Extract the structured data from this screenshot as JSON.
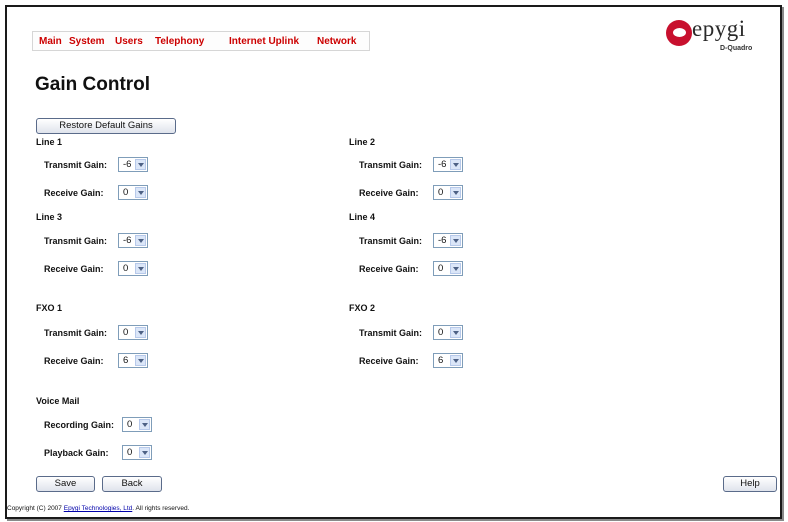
{
  "nav": {
    "items": [
      "Main",
      "System",
      "Users",
      "Telephony",
      "Internet Uplink",
      "Network"
    ]
  },
  "logo": {
    "word": "epygi",
    "sub": "D-Quadro"
  },
  "page_title": "Gain Control",
  "restore_button": "Restore Default Gains",
  "labels": {
    "transmit": "Transmit Gain:",
    "receive": "Receive Gain:",
    "recording": "Recording Gain:",
    "playback": "Playback Gain:"
  },
  "sections": {
    "line1": {
      "title": "Line 1",
      "transmit": "-6",
      "receive": "0"
    },
    "line2": {
      "title": "Line 2",
      "transmit": "-6",
      "receive": "0"
    },
    "line3": {
      "title": "Line 3",
      "transmit": "-6",
      "receive": "0"
    },
    "line4": {
      "title": "Line 4",
      "transmit": "-6",
      "receive": "0"
    },
    "fxo1": {
      "title": "FXO 1",
      "transmit": "0",
      "receive": "6"
    },
    "fxo2": {
      "title": "FXO 2",
      "transmit": "0",
      "receive": "6"
    },
    "voicemail": {
      "title": "Voice Mail",
      "recording": "0",
      "playback": "0"
    }
  },
  "buttons": {
    "save": "Save",
    "back": "Back",
    "help": "Help"
  },
  "footer": {
    "prefix": "Copyright (C) 2007",
    "link": "Epygi Technologies, Ltd",
    "suffix": ". All rights reserved."
  }
}
